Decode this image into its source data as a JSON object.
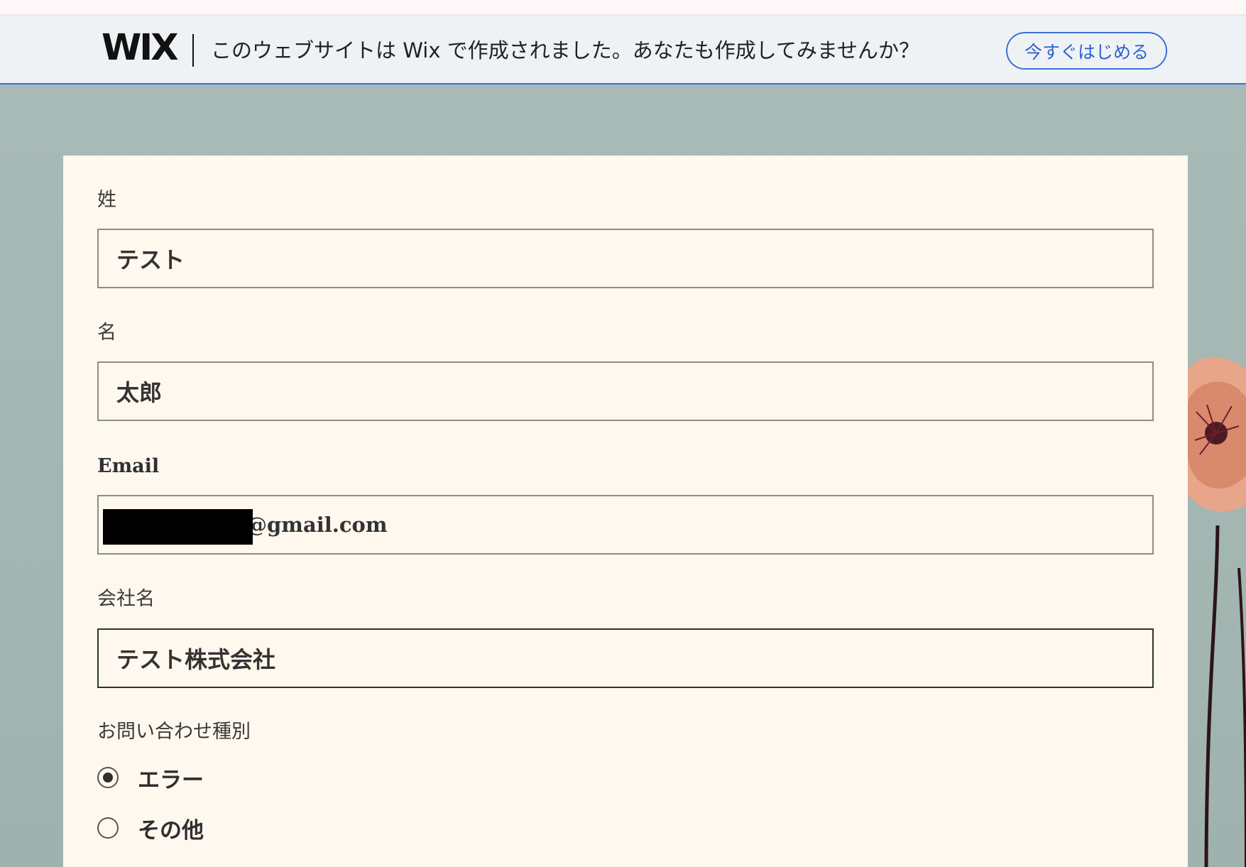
{
  "banner": {
    "logo": "WIX",
    "message": "このウェブサイトは Wix で作成されました。あなたも作成してみませんか？",
    "cta_label": "今すぐはじめる"
  },
  "form": {
    "last_name": {
      "label": "姓",
      "value": "テスト"
    },
    "first_name": {
      "label": "名",
      "value": "太郎"
    },
    "email": {
      "label": "Email",
      "value_visible": "@gmail.com"
    },
    "company": {
      "label": "会社名",
      "value": "テスト株式会社"
    },
    "inquiry_type": {
      "label": "お問い合わせ種別",
      "options": [
        {
          "label": "エラー",
          "checked": true
        },
        {
          "label": "その他",
          "checked": false
        }
      ]
    }
  },
  "colors": {
    "banner_bg": "#eff2f5",
    "accent": "#3b70d6",
    "page_bg": "#a6b8b4",
    "card_bg": "#fff8ee"
  },
  "icons": [
    "flower-image"
  ]
}
